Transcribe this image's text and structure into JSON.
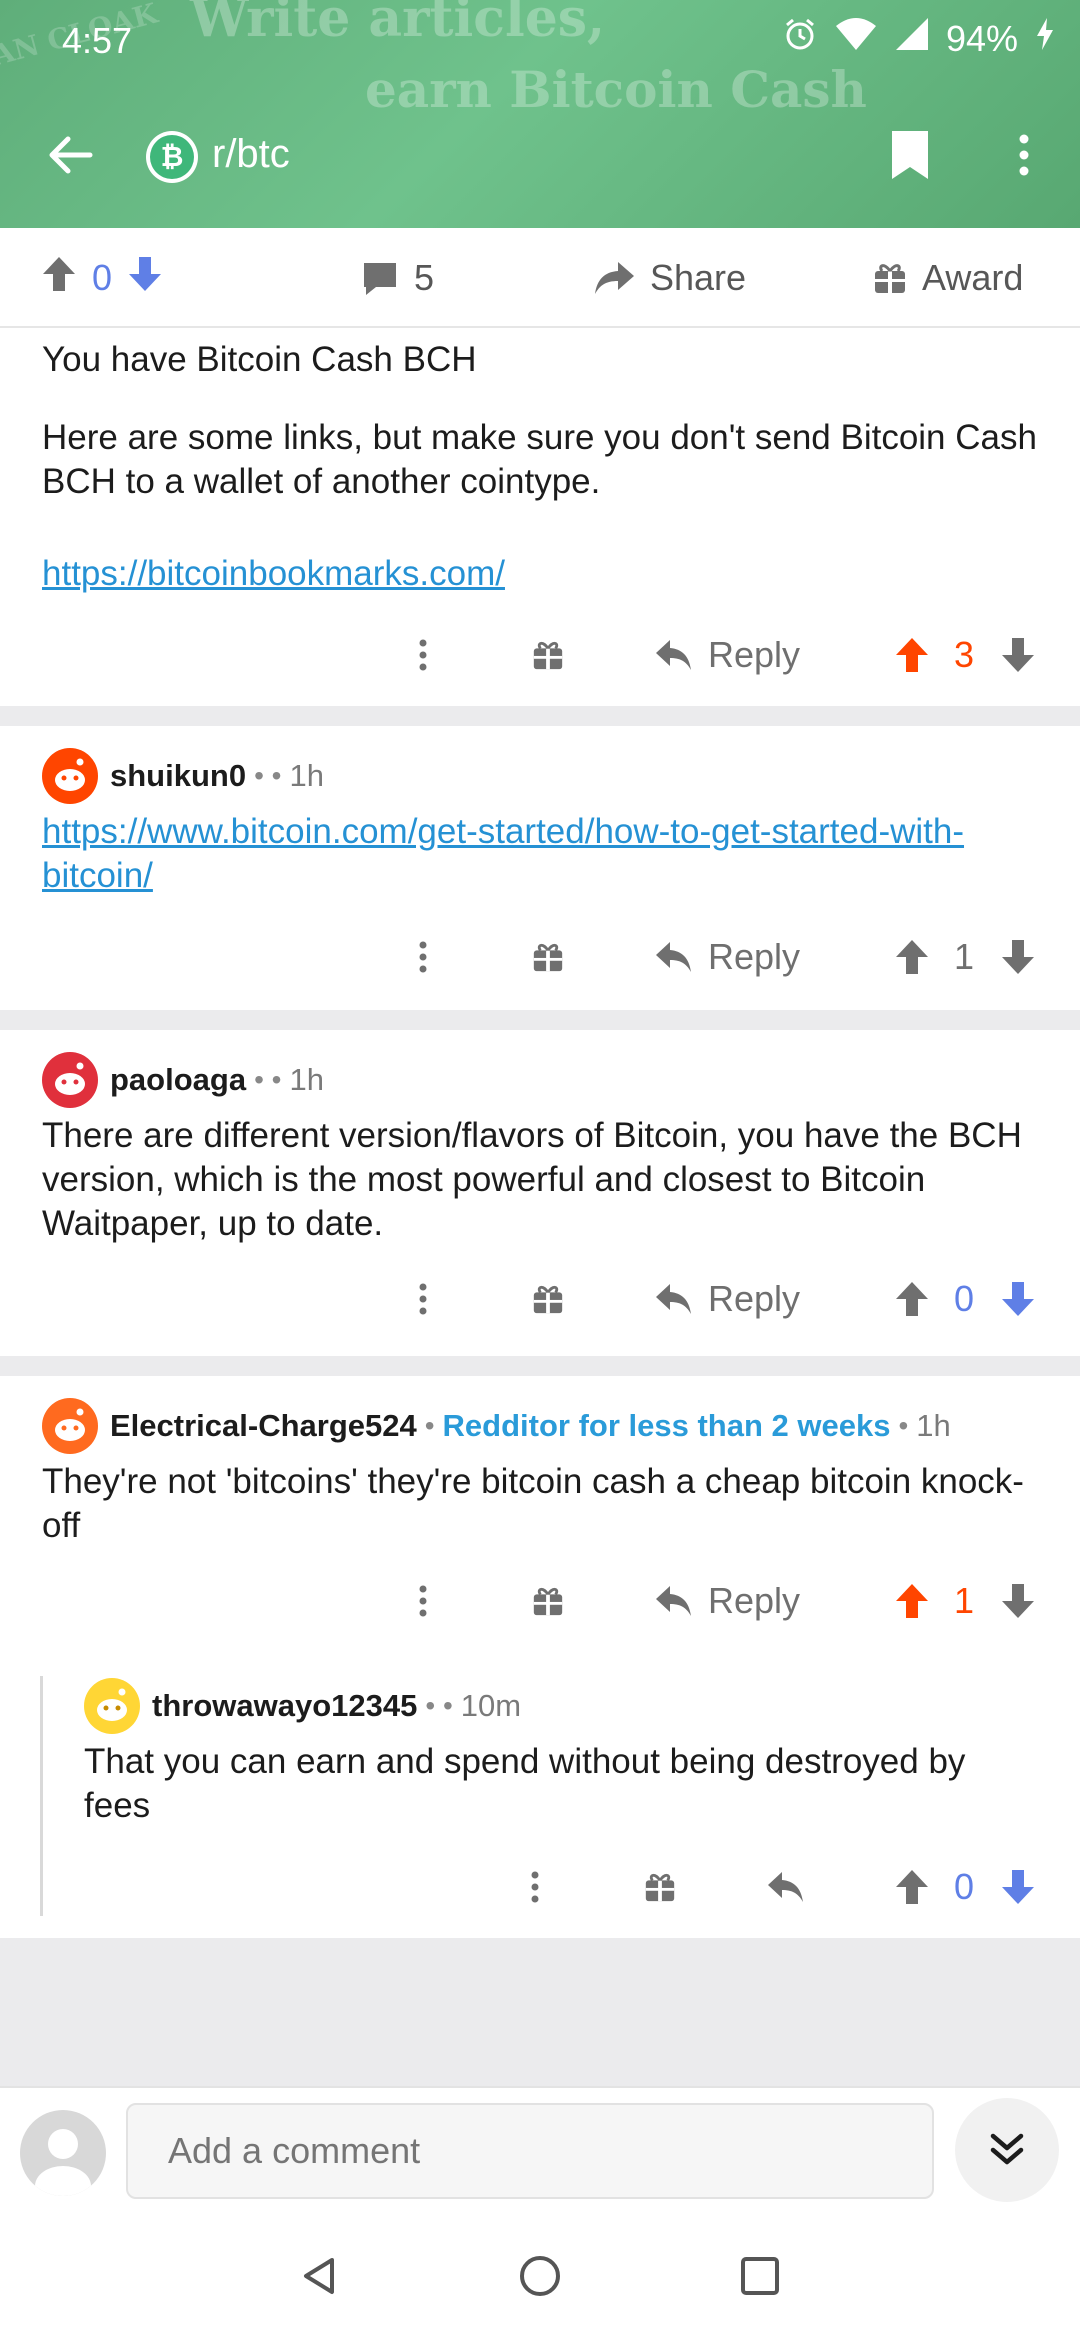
{
  "status_bar": {
    "time": "4:57",
    "battery": "94%"
  },
  "header": {
    "banner_line1": "Write articles,",
    "banner_line2": "earn Bitcoin Cash",
    "banner_ghost": "AN CLOAK",
    "subreddit_icon_letter": "₿",
    "subreddit": "r/btc"
  },
  "action_bar": {
    "score": "0",
    "comment_count": "5",
    "share_label": "Share",
    "award_label": "Award"
  },
  "comments": [
    {
      "line1": "You have Bitcoin Cash BCH",
      "line2": "Here are some links, but make sure you don't send Bitcoin Cash BCH to a wallet of another cointype.",
      "link": "https://bitcoinbookmarks.com/",
      "reply_label": "Reply",
      "score": "3"
    },
    {
      "username": "shuikun0",
      "age": "1h",
      "link": "https://www.bitcoin.com/get-started/how-to-get-started-with-bitcoin/",
      "reply_label": "Reply",
      "score": "1"
    },
    {
      "username": "paoloaga",
      "age": "1h",
      "text": "There are different version/flavors of Bitcoin, you have the BCH version, which is the most powerful and closest to Bitcoin Waitpaper, up to date.",
      "reply_label": "Reply",
      "score": "0"
    },
    {
      "username": "Electrical-Charge524",
      "flair": "Redditor for less than 2 weeks",
      "age": "1h",
      "text": "They're not 'bitcoins' they're bitcoin cash a cheap bitcoin knock-off",
      "reply_label": "Reply",
      "score": "1"
    },
    {
      "username": "throwawayo12345",
      "age": "10m",
      "text": "That you can earn and spend without being destroyed by fees",
      "score": "0"
    }
  ],
  "composer": {
    "placeholder": "Add a comment"
  },
  "colors": {
    "upvote": "#ff4500",
    "downvote": "#5f7fe6",
    "link": "#2591d4",
    "header_green": "#5fae7a"
  }
}
